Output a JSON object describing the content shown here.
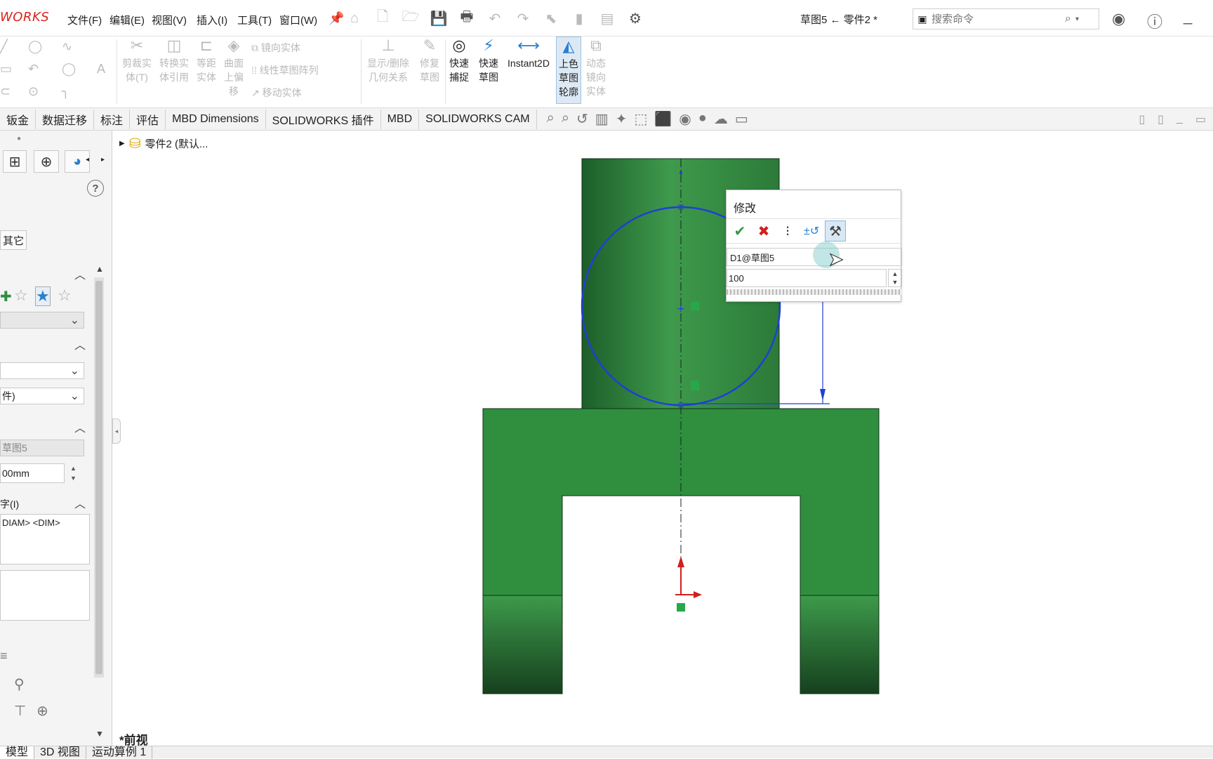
{
  "app": {
    "logo_text": "WORKS",
    "document_title": "草图5 ← 零件2 *"
  },
  "menu": {
    "items": [
      "文件(F)",
      "编辑(E)",
      "视图(V)",
      "插入(I)",
      "工具(T)",
      "窗口(W)"
    ]
  },
  "search": {
    "placeholder": "搜索命令"
  },
  "ribbon": {
    "small_rows": [
      "镜向实体",
      "线性草图阵列",
      "移动实体"
    ],
    "tools": [
      {
        "label": "剪裁实体(T)"
      },
      {
        "label": "转换实体引用"
      },
      {
        "label": "等距实体"
      },
      {
        "label": "曲面上偏移"
      },
      {
        "label": "显示/删除几何关系"
      },
      {
        "label": "修复草图"
      },
      {
        "label": "快速捕捉"
      },
      {
        "label": "快速草图"
      },
      {
        "label": "Instant2D"
      },
      {
        "label": "上色草图轮廓"
      },
      {
        "label": "动态镜向实体"
      }
    ]
  },
  "tabs": [
    "钣金",
    "数据迁移",
    "标注",
    "评估",
    "MBD Dimensions",
    "SOLIDWORKS 插件",
    "MBD",
    "SOLIDWORKS CAM"
  ],
  "left_panel": {
    "other_tab": "其它",
    "field_sketch": "草图5",
    "field_value": "00mm",
    "field_file": "件)",
    "text_label": "字(I)",
    "text_content": "DIAM> <DIM>"
  },
  "tree": {
    "root": "零件2 (默认..."
  },
  "modify_dialog": {
    "title": "修改",
    "dimension_name": "D1@草图5",
    "value": "100"
  },
  "viewport": {
    "view_name": "*前视"
  },
  "colors": {
    "part_green": "#2f8f3f",
    "sketch_blue": "#1f3fd6",
    "accent_red": "#d9251d"
  },
  "bottom_tabs": [
    "模型",
    "3D 视图",
    "运动算例 1"
  ]
}
